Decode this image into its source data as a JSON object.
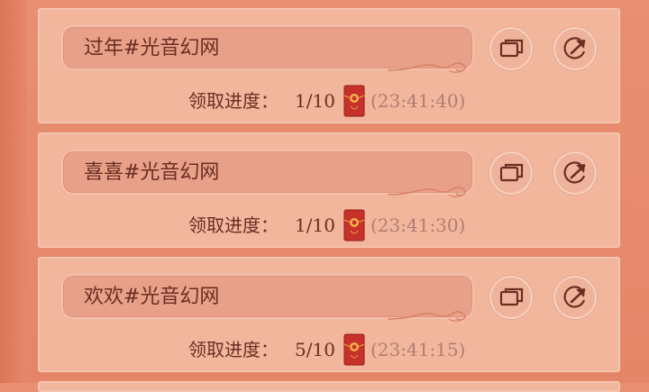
{
  "items": [
    {
      "keyword": "过年#光音幻网",
      "progress_label": "领取进度：",
      "progress": "1/10",
      "time": "(23:41:40)"
    },
    {
      "keyword": "喜喜#光音幻网",
      "progress_label": "领取进度：",
      "progress": "1/10",
      "time": "(23:41:30)"
    },
    {
      "keyword": "欢欢#光音幻网",
      "progress_label": "领取进度：",
      "progress": "5/10",
      "time": "(23:41:15)"
    }
  ],
  "icons": {
    "copy": "copy-icon",
    "share": "share-icon",
    "envelope": "red-envelope-icon"
  },
  "colors": {
    "background": "#e98f72",
    "card": "#f2b69d",
    "text": "#6a2e22",
    "time_text": "#b27d70",
    "envelope": "#c8312a"
  }
}
